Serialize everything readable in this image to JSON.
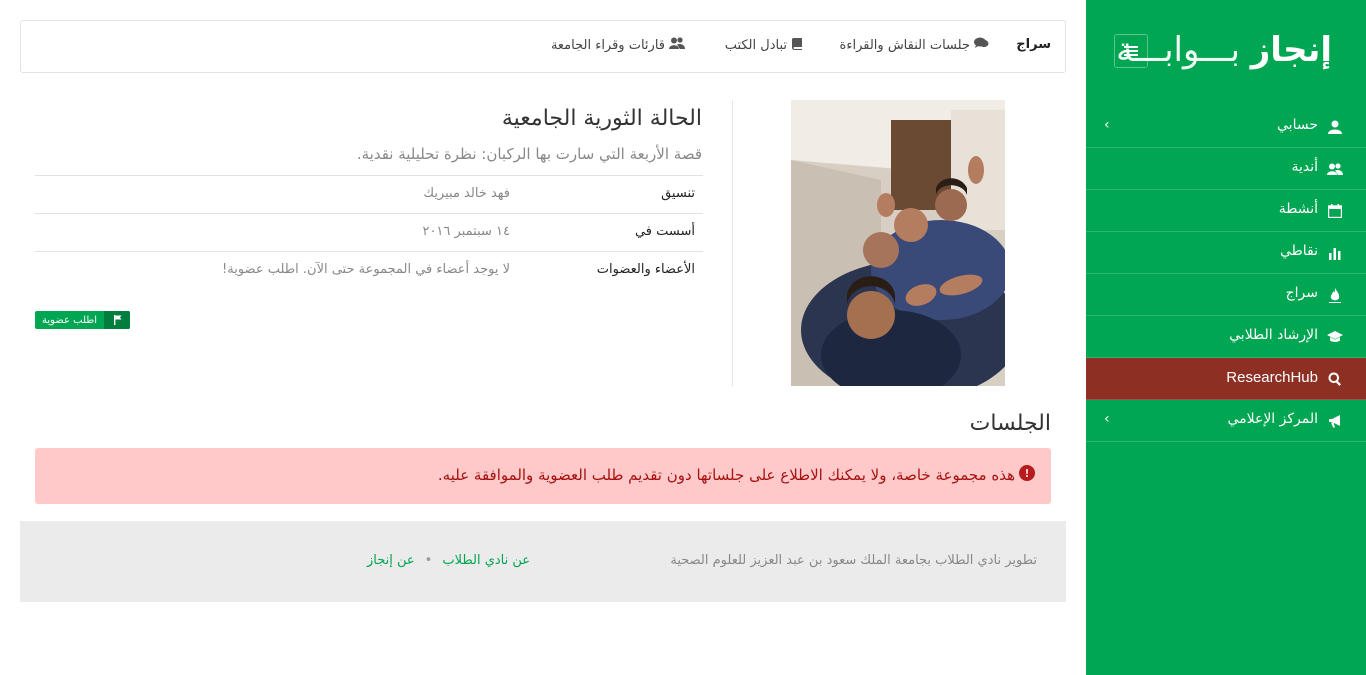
{
  "sidebar": {
    "brand_light": "بـــوابـــة",
    "brand_bold": "إنجاز",
    "items": [
      {
        "label": "حسابي",
        "icon": "user-icon",
        "chevron": "›"
      },
      {
        "label": "أندية",
        "icon": "users-icon",
        "chevron": ""
      },
      {
        "label": "أنشطة",
        "icon": "calendar-icon",
        "chevron": ""
      },
      {
        "label": "نقاطي",
        "icon": "bar-chart-icon",
        "chevron": ""
      },
      {
        "label": "سراج",
        "icon": "flame-icon",
        "chevron": ""
      },
      {
        "label": "الإرشاد الطلابي",
        "icon": "graduation-cap-icon",
        "chevron": ""
      },
      {
        "label": "ResearchHub",
        "icon": "search-icon",
        "chevron": ""
      },
      {
        "label": "المركز الإعلامي",
        "icon": "bullhorn-icon",
        "chevron": "›"
      }
    ],
    "active_index": 6
  },
  "topbar": {
    "tabs": [
      {
        "label": "سراج",
        "icon": ""
      },
      {
        "label": "جلسات النقاش والقراءة",
        "icon": "comments-icon"
      },
      {
        "label": "تبادل الكتب",
        "icon": "book-icon"
      },
      {
        "label": "قارئات وقراء الجامعة",
        "icon": "users-icon"
      }
    ]
  },
  "group": {
    "title": "الحالة الثورية الجامعية",
    "subtitle": "قصة الأربعة التي سارت بها الركبان: نظرة تحليلية نقدية.",
    "info": [
      {
        "key": "تنسيق",
        "value": "فهد خالد مبيريك"
      },
      {
        "key": "أسست في",
        "value": "١٤ سبتمبر ٢٠١٦"
      },
      {
        "key": "الأعضاء والعضوات",
        "value": "لا يوجد أعضاء في المجموعة حتى الآن. اطلب عضوية!"
      }
    ],
    "join_label": "اطلب عضوية"
  },
  "sessions": {
    "title": "الجلسات",
    "alert": "هذه مجموعة خاصة، ولا يمكنك الاطلاع على جلساتها دون تقديم طلب العضوية والموافقة عليه."
  },
  "footer": {
    "credit": "تطوير نادي الطلاب بجامعة الملك سعود بن عبد العزيز للعلوم الصحية",
    "links": [
      "عن نادي الطلاب",
      "عن إنجاز"
    ],
    "separator": "•"
  },
  "colors": {
    "brand_green": "#00a651",
    "active_item": "#8e2f24",
    "alert_bg": "#ffc9c9",
    "alert_text": "#a61212"
  }
}
